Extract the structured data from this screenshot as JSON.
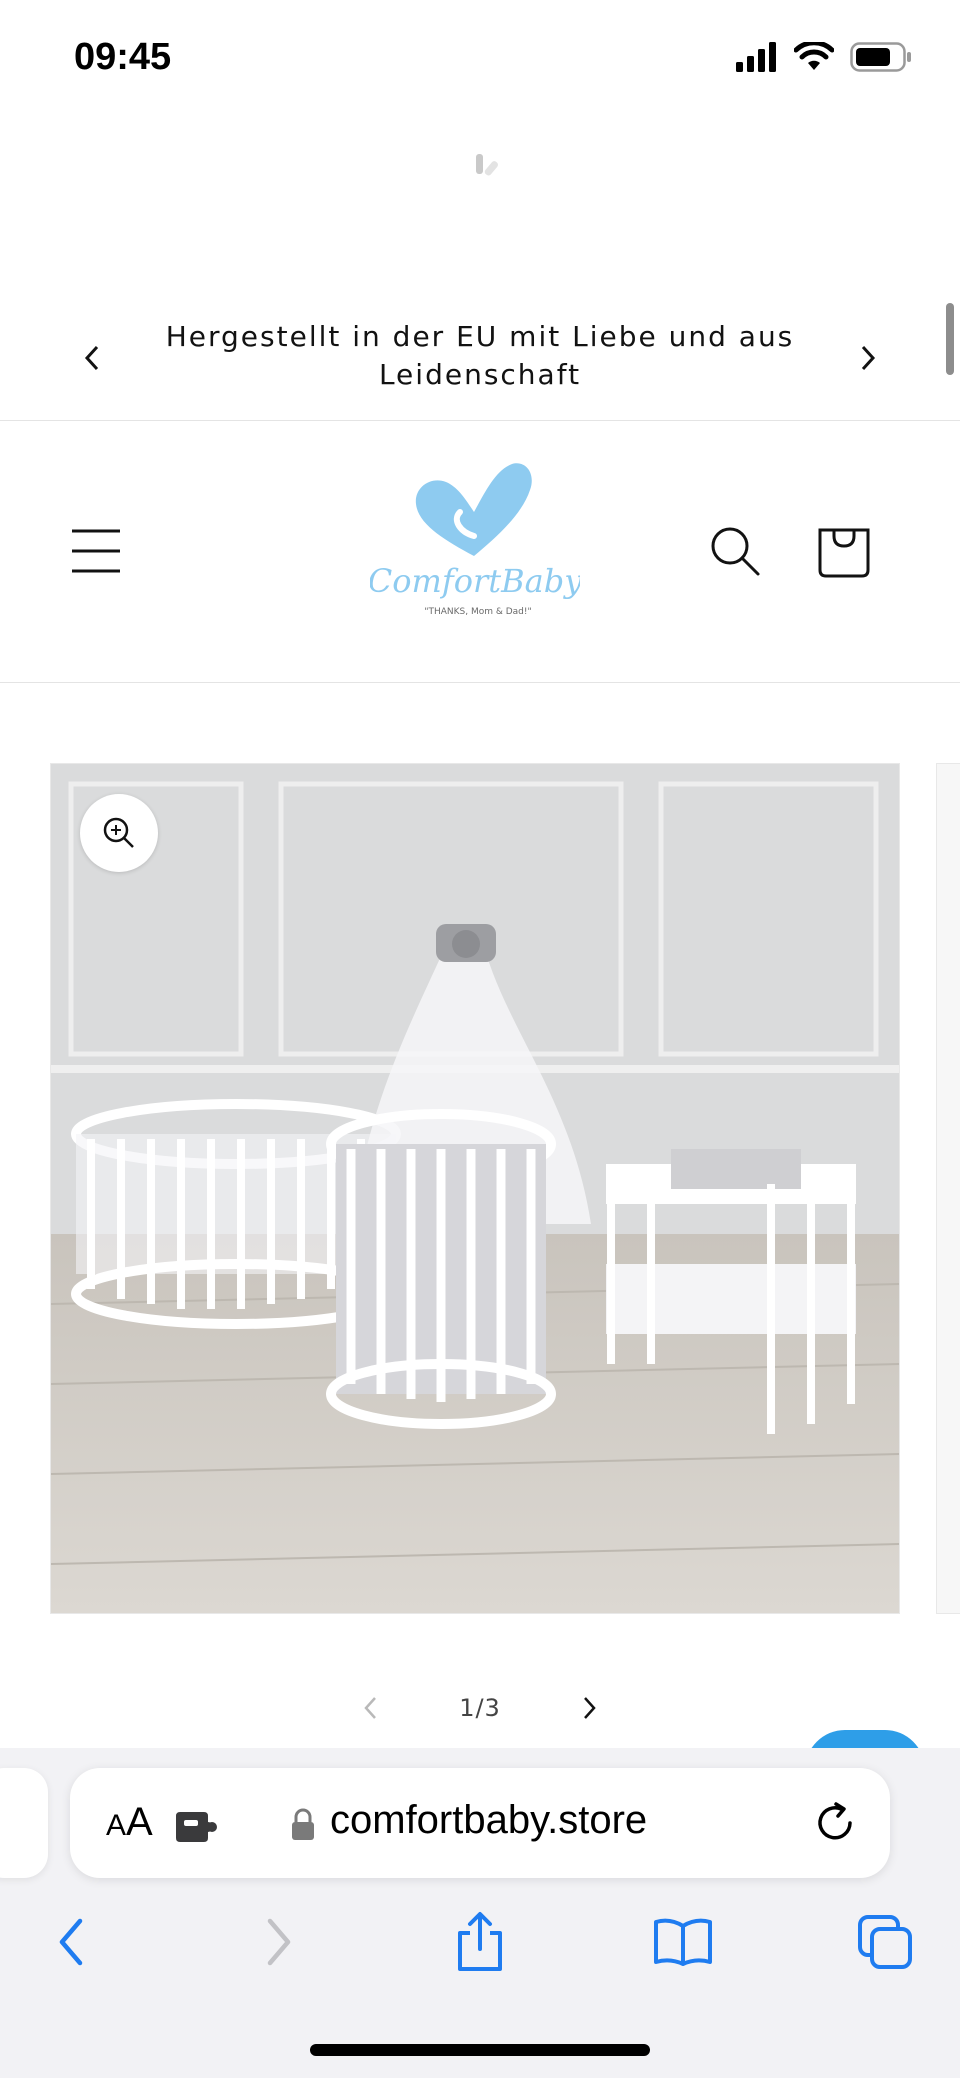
{
  "status_bar": {
    "time": "09:45"
  },
  "announcement": {
    "text": "Hergestellt in der EU mit Liebe und aus Leidenschaft"
  },
  "header": {
    "logo_text": "ComfortBaby",
    "logo_tagline": "\"THANKS, Mom & Dad!\""
  },
  "gallery": {
    "current": 1,
    "total": 3,
    "counter_text": "1/3"
  },
  "browser": {
    "aa_small": "A",
    "aa_large": "A",
    "url": "comfortbaby.store"
  },
  "colors": {
    "accent_blue": "#1f7cf0",
    "logo_blue": "#8ecbf0",
    "chat_blue": "#2e9ee8"
  }
}
